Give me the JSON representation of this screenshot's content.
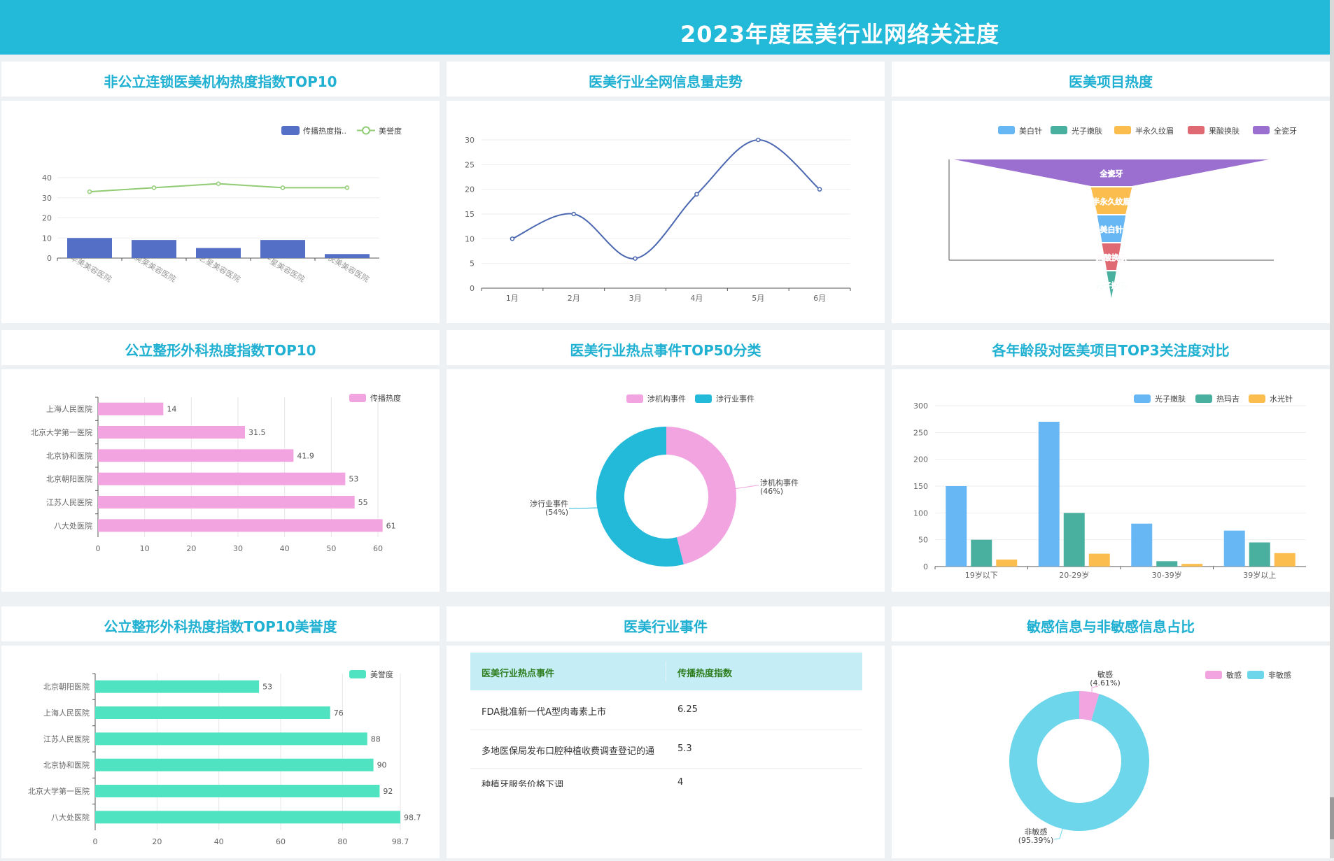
{
  "header": {
    "title": "2023年度医美行业网络关注度"
  },
  "panels": {
    "p1": {
      "title": "非公立连锁医美机构热度指数TOP10"
    },
    "p2": {
      "title": "医美行业全网信息量走势"
    },
    "p3": {
      "title": "医美项目热度"
    },
    "p4": {
      "title": "公立整形外科热度指数TOP10"
    },
    "p5": {
      "title": "医美行业热点事件TOP50分类"
    },
    "p6": {
      "title": "各年龄段对医美项目TOP3关注度对比"
    },
    "p7": {
      "title": "公立整形外科热度指数TOP10美誉度"
    },
    "p8": {
      "title": "医美行业事件"
    },
    "p9": {
      "title": "敏感信息与非敏感信息占比"
    }
  },
  "table": {
    "headers": [
      "医美行业热点事件",
      "传播热度指数"
    ],
    "rows": [
      [
        "FDA批准新一代A型肉毒素上市",
        "6.25"
      ],
      [
        "多地医保局发布口腔种植收费调查登记的通",
        "5.3"
      ],
      [
        "种植牙服务价格下调",
        "4"
      ]
    ]
  },
  "colors": {
    "header_bg": "#23b9d9",
    "title": "#1fb0d2",
    "bar_blue": "#5470c6",
    "line_green": "#91cc75",
    "line_blue": "#4a67b0",
    "pink": "#f2a4e0",
    "cyan": "#23b9d9",
    "mint": "#4fe3c1",
    "sky": "#68b7f5",
    "teal": "#49b0a0",
    "amber": "#fbbd4e",
    "rose": "#e06a73",
    "purple": "#9a6fd0",
    "light_cyan": "#6dd6ea"
  },
  "chart_data": [
    {
      "id": "c1",
      "type": "bar",
      "categories": [
        "华美美容医院",
        "美莱美容医院",
        "艺星美容医院",
        "一星美容医院",
        "悦美美容医院"
      ],
      "series": [
        {
          "name": "传播热度指..",
          "type": "bar",
          "values": [
            10,
            9,
            5,
            9,
            2
          ]
        },
        {
          "name": "美誉度",
          "type": "line",
          "values": [
            33,
            35,
            37,
            35,
            35
          ]
        }
      ],
      "yticks": [
        "0",
        "10",
        "20",
        "30",
        "40"
      ],
      "ylim": [
        0,
        40
      ],
      "legend": "top-right"
    },
    {
      "id": "c2",
      "type": "line",
      "categories": [
        "1月",
        "2月",
        "3月",
        "4月",
        "5月",
        "6月"
      ],
      "values": [
        10,
        15,
        6,
        19,
        30,
        20
      ],
      "yticks": [
        "0",
        "5",
        "10",
        "15",
        "20",
        "25",
        "30"
      ],
      "ylim": [
        0,
        30
      ],
      "smooth": true
    },
    {
      "id": "c3",
      "type": "funnel",
      "legend": [
        "美白针",
        "光子嫩肤",
        "半永久纹眉",
        "果酸换肤",
        "全瓷牙"
      ],
      "stages": [
        {
          "name": "全瓷牙",
          "value": 100
        },
        {
          "name": "半永久纹眉",
          "value": 13
        },
        {
          "name": "美白针",
          "value": 9
        },
        {
          "name": "果酸换肤",
          "value": 6
        },
        {
          "name": "光子嫩肤",
          "value": 3
        }
      ]
    },
    {
      "id": "c4",
      "type": "bar",
      "orientation": "horizontal",
      "categories": [
        "上海人民医院",
        "北京大学第一医院",
        "北京协和医院",
        "北京朝阳医院",
        "江苏人民医院",
        "八大处医院"
      ],
      "series": [
        {
          "name": "传播热度",
          "values": [
            14,
            31.5,
            41.9,
            53,
            55,
            61
          ]
        }
      ],
      "value_labels": [
        "14",
        "31.5",
        "41.9",
        "53",
        "55",
        "61"
      ],
      "xticks": [
        "0",
        "10",
        "20",
        "30",
        "40",
        "50",
        "60"
      ],
      "xlim": [
        0,
        60
      ],
      "legend": "top-right"
    },
    {
      "id": "c5",
      "type": "pie",
      "donut": true,
      "legend": [
        "涉机构事件",
        "涉行业事件"
      ],
      "slices": [
        {
          "name": "涉机构事件",
          "value": 46,
          "label": "涉机构事件",
          "pct": "(46%)"
        },
        {
          "name": "涉行业事件",
          "value": 54,
          "label": "涉行业事件",
          "pct": "(54%)"
        }
      ]
    },
    {
      "id": "c6",
      "type": "bar",
      "categories": [
        "19岁以下",
        "20-29岁",
        "30-39岁",
        "39岁以上"
      ],
      "series": [
        {
          "name": "光子嫩肤",
          "values": [
            150,
            270,
            80,
            67
          ]
        },
        {
          "name": "热玛吉",
          "values": [
            50,
            100,
            10,
            45
          ]
        },
        {
          "name": "水光针",
          "values": [
            13,
            24,
            5,
            25
          ]
        }
      ],
      "yticks": [
        "0",
        "50",
        "100",
        "150",
        "200",
        "250",
        "300"
      ],
      "ylim": [
        0,
        300
      ],
      "legend": "top-right"
    },
    {
      "id": "c7",
      "type": "bar",
      "orientation": "horizontal",
      "categories": [
        "北京朝阳医院",
        "上海人民医院",
        "江苏人民医院",
        "北京协和医院",
        "北京大学第一医院",
        "八大处医院"
      ],
      "series": [
        {
          "name": "美誉度",
          "values": [
            53,
            76,
            88,
            90,
            92,
            98.7
          ]
        }
      ],
      "value_labels": [
        "53",
        "76",
        "88",
        "90",
        "92",
        "98.7"
      ],
      "xticks": [
        "0",
        "20",
        "40",
        "60",
        "80",
        "98.7"
      ],
      "xlim": [
        0,
        98.7
      ],
      "legend": "top-right"
    },
    {
      "id": "c9",
      "type": "pie",
      "donut": true,
      "legend": [
        "敏感",
        "非敏感"
      ],
      "slices": [
        {
          "name": "敏感",
          "value": 4.61,
          "label": "敏感",
          "pct": "(4.61%)"
        },
        {
          "name": "非敏感",
          "value": 95.39,
          "label": "非敏感",
          "pct": "(95.39%)"
        }
      ]
    }
  ]
}
